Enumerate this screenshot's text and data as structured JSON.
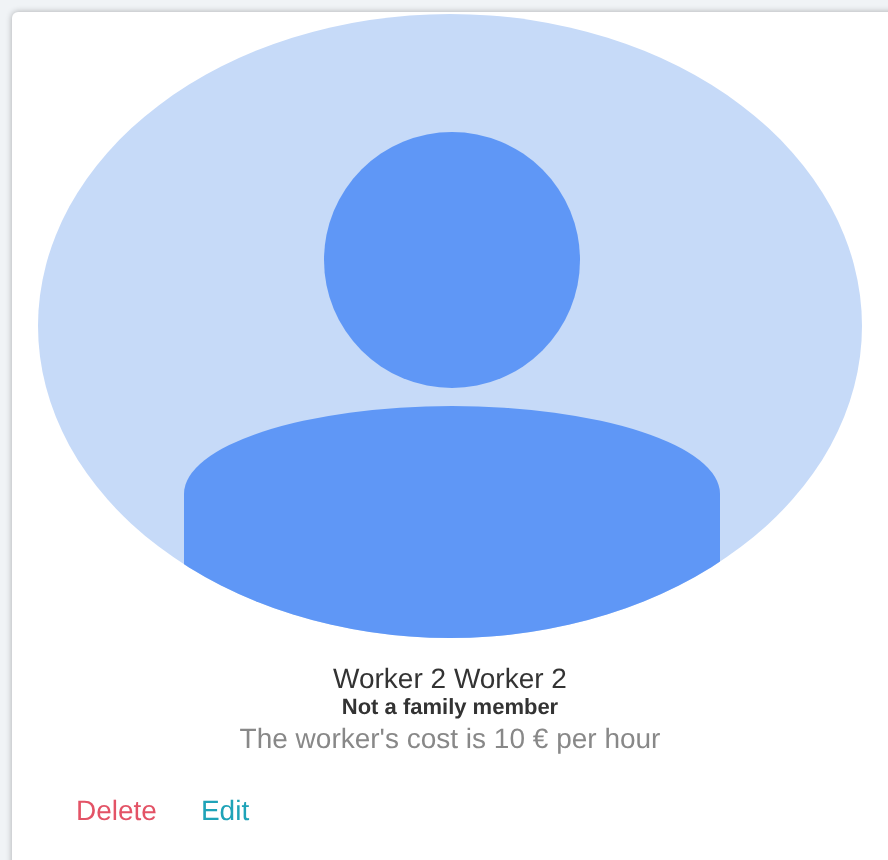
{
  "worker": {
    "name": "Worker 2 Worker 2",
    "family_status": "Not a family member",
    "cost": "The worker's cost is 10 € per hour"
  },
  "actions": [
    {
      "label": "Delete",
      "kind": "danger"
    },
    {
      "label": "Edit",
      "kind": "info"
    }
  ]
}
